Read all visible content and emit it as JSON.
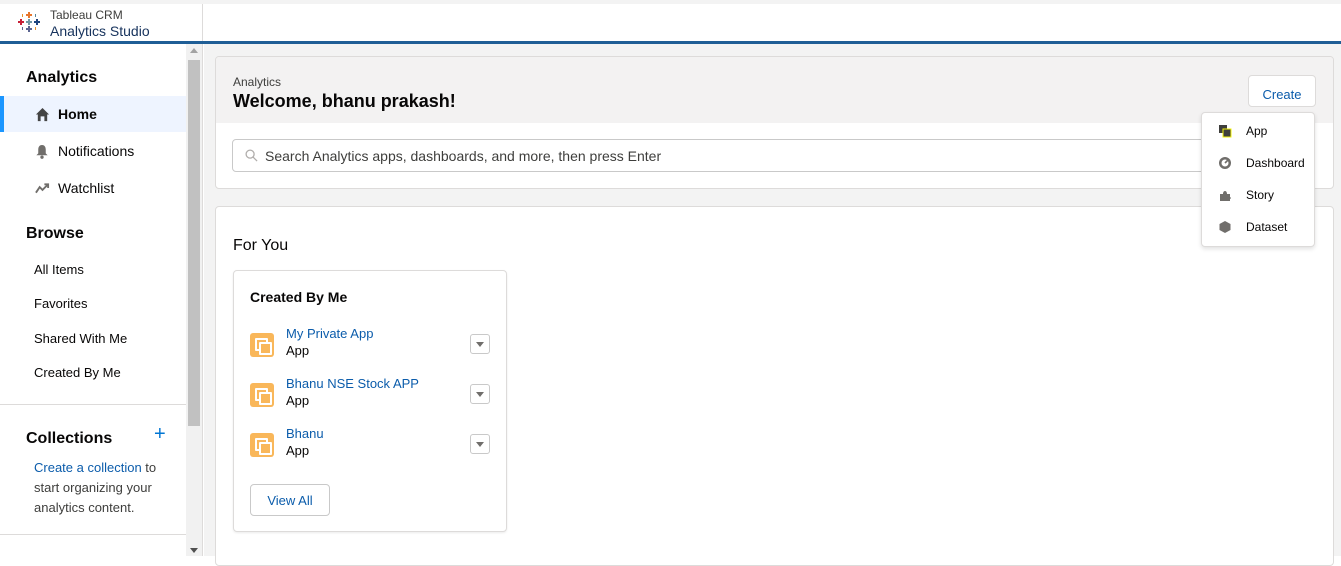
{
  "brand": {
    "line1": "Tableau CRM",
    "line2": "Analytics Studio"
  },
  "sidebar": {
    "analytics_title": "Analytics",
    "nav": [
      {
        "label": "Home",
        "icon": "home-icon",
        "active": true
      },
      {
        "label": "Notifications",
        "icon": "bell-icon"
      },
      {
        "label": "Watchlist",
        "icon": "trend-icon"
      }
    ],
    "browse_title": "Browse",
    "browse": [
      "All Items",
      "Favorites",
      "Shared With Me",
      "Created By Me"
    ],
    "collections_title": "Collections",
    "collections_link": "Create a collection",
    "collections_rest": " to start organizing your analytics content."
  },
  "header": {
    "subtitle": "Analytics",
    "title": "Welcome, bhanu prakash!",
    "create_label": "Create"
  },
  "search": {
    "placeholder": "Search Analytics apps, dashboards, and more, then press Enter"
  },
  "foryou": {
    "title": "For You",
    "card_title": "Created By Me",
    "apps": [
      {
        "name": "My Private App",
        "type": "App"
      },
      {
        "name": "Bhanu NSE Stock APP",
        "type": "App"
      },
      {
        "name": "Bhanu",
        "type": "App"
      }
    ],
    "view_all": "View All"
  },
  "create_menu": [
    "App",
    "Dashboard",
    "Story",
    "Dataset"
  ],
  "colors": {
    "accent": "#0176d3",
    "link": "#0b5cab",
    "highlight": "#f4f40a",
    "app_icon": "#f9b75a",
    "header_rule": "#1f5e96"
  }
}
